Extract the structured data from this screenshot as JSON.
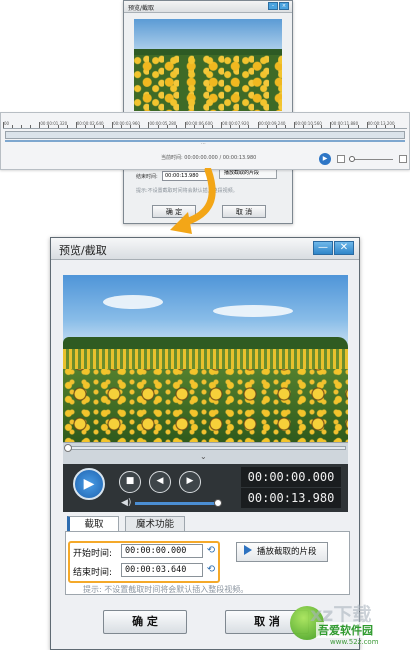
{
  "small_dialog": {
    "title": "预览/截取",
    "end_time_label": "结束时间:",
    "end_time_value": "00:00:13.980",
    "play_clip_label": "播放截取的片段",
    "hint": "提示:不设置截取时间将会默认插入整段视频。",
    "ok_label": "确 定",
    "cancel_label": "取 消"
  },
  "timeline": {
    "ruler_ticks": [
      "00",
      "00:00:01.320",
      "00:00:02.640",
      "00:00:03.960",
      "00:00:05.280",
      "00:00:06.600",
      "00:00:07.920",
      "00:00:09.240",
      "00:00:10.560",
      "00:00:11.880",
      "00:00:13.200"
    ],
    "current_time_text": "当前时间: 00:00:00.000 / 00:00:13.980",
    "scroll_dots": "···"
  },
  "dialog": {
    "title": "预览/截取",
    "minimize_glyph": "—",
    "close_glyph": "✕",
    "current_time": "00:00:00.000",
    "total_time": "00:00:13.980",
    "tabs": [
      {
        "label": "截取",
        "active": true
      },
      {
        "label": "魔术功能",
        "active": false
      }
    ],
    "start_time_label": "开始时间:",
    "start_time_value": "00:00:00.000",
    "end_time_label": "结束时间:",
    "end_time_value": "00:00:03.640",
    "play_clip_label": "播放截取的片段",
    "hint": "提示: 不设置截取时间将会默认插入整段视频。",
    "ok_label": "确 定",
    "cancel_label": "取 消"
  },
  "watermark": {
    "big_text": "xz下载",
    "site_name": "吾爱软件园",
    "url": "www.52z.com"
  },
  "colors": {
    "highlight": "#f4a92a",
    "accent_blue": "#2e6db0",
    "player_bg": "#2f3437"
  },
  "icons": [
    "play-icon",
    "stop-icon",
    "previous-frame-icon",
    "next-frame-icon",
    "volume-icon",
    "clock-reset-icon",
    "minimize-icon",
    "close-icon",
    "chevron-down-icon"
  ]
}
